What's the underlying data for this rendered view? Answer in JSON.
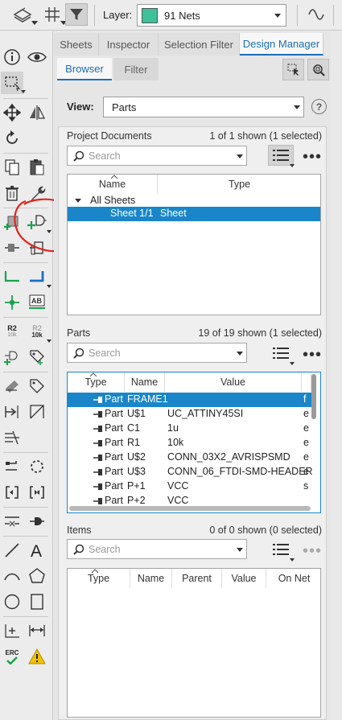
{
  "toolbar": {
    "layer_label": "Layer:",
    "layer_value": "91 Nets",
    "layer_color": "#3ec09a"
  },
  "left_toolbar": {
    "icons": [
      "info-icon",
      "eye-icon",
      "select-box-icon",
      "move-icon",
      "mirror-icon",
      "rotate-icon",
      "copy-icon",
      "paste-icon",
      "delete-icon",
      "wrench-icon",
      "add-part-icon",
      "add-gate-icon",
      "split-icon",
      "replace-icon",
      "wire-icon",
      "bus-icon",
      "junction-icon",
      "label-icon",
      "name-icon",
      "value-icon",
      "pin-swap-icon",
      "attribute-icon",
      "connect-icon",
      "miter-icon",
      "split-wire-icon",
      "slice-icon",
      "group-icon",
      "gate-swap-icon",
      "invoke-icon",
      "port-icon",
      "pinswap-icon",
      "line-icon",
      "text-icon",
      "arc-icon",
      "polygon-icon",
      "circle-icon",
      "rectangle-icon",
      "mark-icon",
      "dimension-icon",
      "erc-icon",
      "warning-icon"
    ],
    "labels": {
      "name_top": "R2",
      "name_bottom": "10k",
      "value_top": "R2",
      "value_bottom": "10k",
      "erc": "ERC",
      "ab": "AB"
    }
  },
  "tabs": [
    "Sheets",
    "Inspector",
    "Selection Filter",
    "Design Manager"
  ],
  "active_tab": "Design Manager",
  "subtabs": [
    "Browser",
    "Filter"
  ],
  "view": {
    "label": "View:",
    "value": "Parts"
  },
  "project_documents": {
    "title": "Project Documents",
    "count": "1 of 1 shown (1 selected)",
    "search_placeholder": "Search",
    "columns": [
      "Name",
      "Type"
    ],
    "tree_root": "All Sheets",
    "rows": [
      {
        "name": "Sheet 1/1",
        "type": "Sheet",
        "selected": true
      }
    ]
  },
  "parts": {
    "title": "Parts",
    "count": "19 of 19 shown (1 selected)",
    "search_placeholder": "Search",
    "columns": [
      "Type",
      "Name",
      "Value"
    ],
    "rows": [
      {
        "type": "Part",
        "name": "FRAME1",
        "value": "",
        "extra": "f",
        "selected": true
      },
      {
        "type": "Part",
        "name": "U$1",
        "value": "UC_ATTINY45SI",
        "extra": "e"
      },
      {
        "type": "Part",
        "name": "C1",
        "value": "1u",
        "extra": "e"
      },
      {
        "type": "Part",
        "name": "R1",
        "value": "10k",
        "extra": "e"
      },
      {
        "type": "Part",
        "name": "U$2",
        "value": "CONN_03X2_AVRISPSMD",
        "extra": "e"
      },
      {
        "type": "Part",
        "name": "U$3",
        "value": "CONN_06_FTDI-SMD-HEADER",
        "extra": "e"
      },
      {
        "type": "Part",
        "name": "P+1",
        "value": "VCC",
        "extra": "s"
      },
      {
        "type": "Part",
        "name": "P+2",
        "value": "VCC",
        "extra": ""
      }
    ]
  },
  "items": {
    "title": "Items",
    "count": "0 of 0 shown (0 selected)",
    "search_placeholder": "Search",
    "columns": [
      "Type",
      "Name",
      "Parent",
      "Value",
      "On Net"
    ]
  },
  "annotation_color": "#e2231a"
}
